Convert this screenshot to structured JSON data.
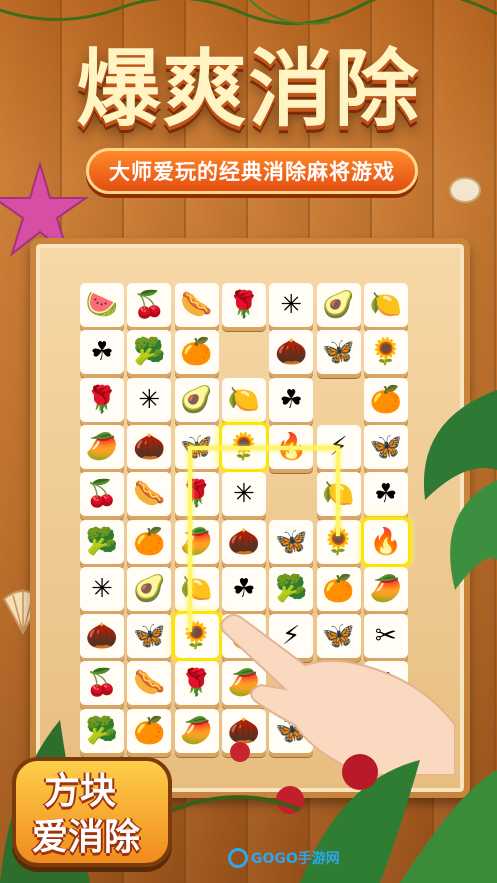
{
  "title": "爆爽消除",
  "subtitle": "大师爱玩的经典消除麻将游戏",
  "logo": {
    "line1": "方块",
    "line2": "爱消除"
  },
  "watermark": "GOGO手游网",
  "colors": {
    "accent": "#ff8a2a",
    "highlight": "#ffe400",
    "wood": "#c97a32"
  },
  "board": {
    "rows": [
      [
        "watermelon",
        "cherry",
        "sausage",
        "rose",
        "pinwheel",
        "avocado",
        "lime"
      ],
      [
        "clover",
        "broccoli",
        "orange",
        "",
        "chestnut",
        "dragonfly",
        "sunflower"
      ],
      [
        "rose",
        "pinwheel",
        "avocado",
        "lime",
        "clover",
        "",
        "orange"
      ],
      [
        "papaya",
        "chestnut",
        "dragonfly",
        "sunflower",
        "flame",
        "lightning",
        "butterfly"
      ],
      [
        "cherry",
        "sausage",
        "rose",
        "pinwheel",
        "",
        "lime",
        "clover"
      ],
      [
        "broccoli",
        "orange",
        "papaya",
        "chestnut",
        "dragonfly",
        "sunflower",
        "flame"
      ],
      [
        "pinwheel",
        "avocado",
        "lime",
        "clover",
        "broccoli",
        "orange",
        "papaya"
      ],
      [
        "chestnut",
        "dragonfly",
        "sunflower",
        "flame",
        "lightning",
        "butterfly",
        "scissors"
      ],
      [
        "cherry",
        "sausage",
        "rose",
        "papaya",
        "",
        "",
        "clover"
      ],
      [
        "broccoli",
        "orange",
        "papaya",
        "chestnut",
        "dragonfly",
        "",
        "lime"
      ]
    ],
    "selected": [
      [
        3,
        3
      ],
      [
        5,
        6
      ],
      [
        7,
        2
      ]
    ]
  },
  "icons": {
    "watermelon": "🍉",
    "cherry": "🍒",
    "sausage": "🌭",
    "rose": "🌹",
    "pinwheel": "✳",
    "avocado": "🥑",
    "lime": "🍋",
    "clover": "☘",
    "broccoli": "🥦",
    "orange": "🍊",
    "chestnut": "🌰",
    "dragonfly": "🦋",
    "sunflower": "🌻",
    "flame": "🔥",
    "lightning": "⚡",
    "butterfly": "🦋",
    "papaya": "🥭",
    "scissors": "✂"
  }
}
